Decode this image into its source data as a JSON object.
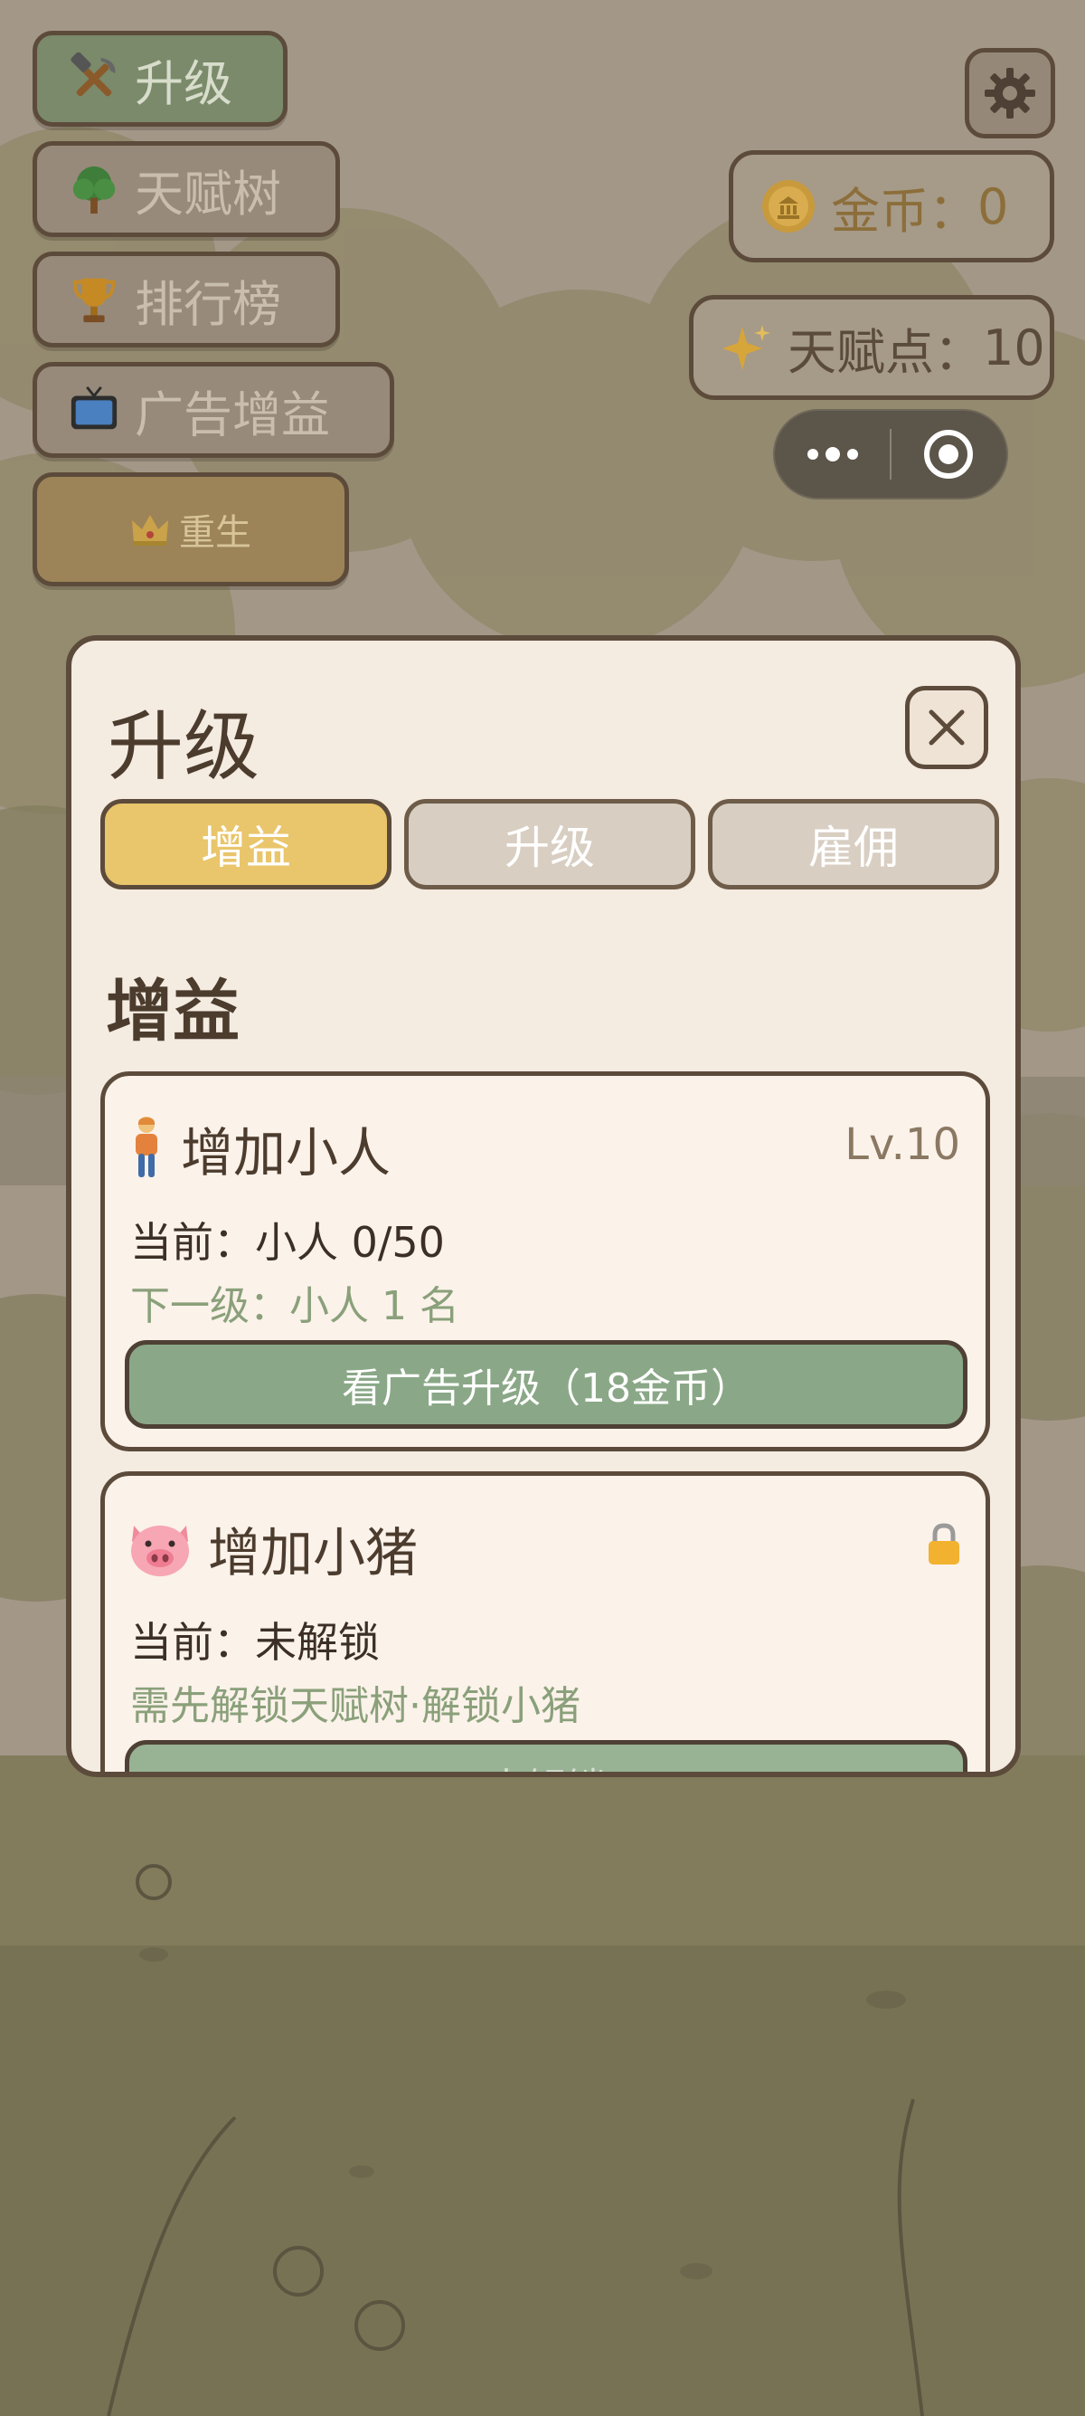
{
  "menu": {
    "upgrade_label": "升级",
    "talent_tree_label": "天赋树",
    "leaderboard_label": "排行榜",
    "ad_boost_label": "广告增益",
    "rebirth_label": "重生"
  },
  "stats": {
    "coins_label": "金币：",
    "coins_value": "0",
    "talent_label": "天赋点：",
    "talent_value": "10"
  },
  "modal": {
    "title": "升级",
    "tabs": [
      {
        "label": "增益",
        "active": true
      },
      {
        "label": "升级",
        "active": false
      },
      {
        "label": "雇佣",
        "active": false
      }
    ],
    "section_title": "增益",
    "cards": [
      {
        "name": "增加小人",
        "icon": "person-icon",
        "level": "Lv.10",
        "current": "当前：小人 0/50",
        "next": "下一级：小人 1 名",
        "button": "看广告升级（18金币）"
      },
      {
        "name": "增加小猪",
        "icon": "pig-icon",
        "status_icon": "lock-icon",
        "current": "当前：未解锁",
        "next": "需先解锁天赋树·解锁小猪",
        "button": "未解锁"
      }
    ]
  },
  "colors": {
    "accent_tab": "#e9c56b",
    "button_green": "#8aa887",
    "border_brown": "#5c4b3b",
    "panel_bg": "#f4ebe1"
  }
}
